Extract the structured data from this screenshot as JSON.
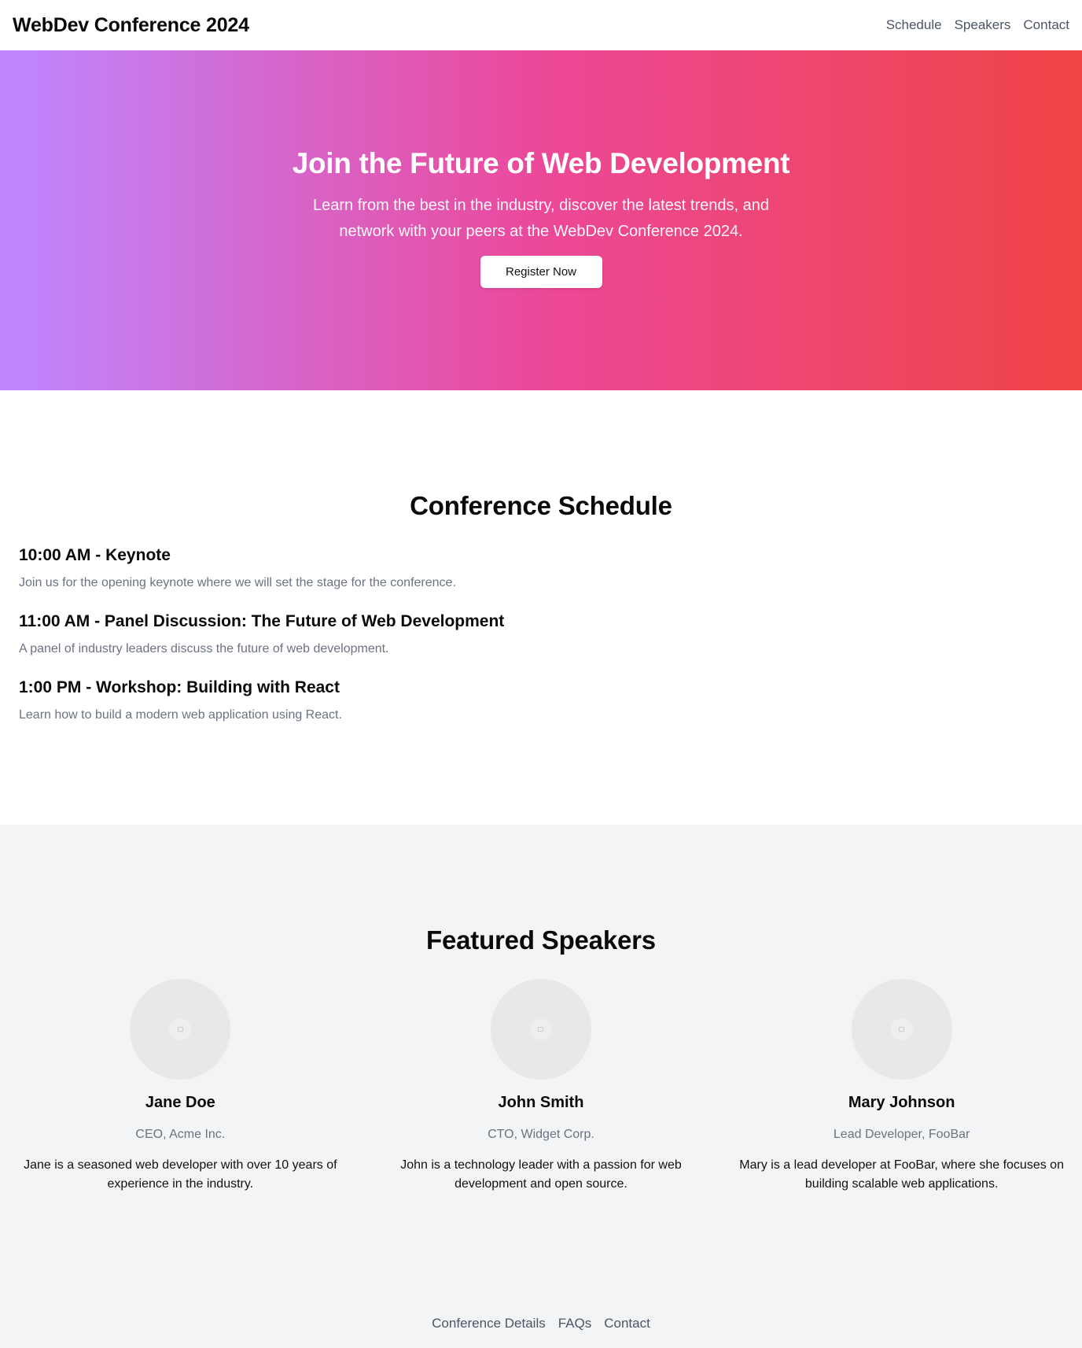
{
  "header": {
    "title": "WebDev Conference 2024",
    "nav": [
      "Schedule",
      "Speakers",
      "Contact"
    ]
  },
  "hero": {
    "title": "Join the Future of Web Development",
    "subtitle": "Learn from the best in the industry, discover the latest trends, and network with your peers at the WebDev Conference 2024.",
    "button_label": "Register Now",
    "gradient_colors": [
      "#c084fc",
      "#ec4899",
      "#ef4444"
    ]
  },
  "schedule": {
    "title": "Conference Schedule",
    "items": [
      {
        "heading": "10:00 AM - Keynote",
        "description": "Join us for the opening keynote where we will set the stage for the conference."
      },
      {
        "heading": "11:00 AM - Panel Discussion: The Future of Web Development",
        "description": "A panel of industry leaders discuss the future of web development."
      },
      {
        "heading": "1:00 PM - Workshop: Building with React",
        "description": "Learn how to build a modern web application using React."
      }
    ]
  },
  "speakers": {
    "title": "Featured Speakers",
    "items": [
      {
        "name": "Jane Doe",
        "role": "CEO, Acme Inc.",
        "bio": "Jane is a seasoned web developer with over 10 years of experience in the industry.",
        "avatar_icon": "image-placeholder-icon"
      },
      {
        "name": "John Smith",
        "role": "CTO, Widget Corp.",
        "bio": "John is a technology leader with a passion for web development and open source.",
        "avatar_icon": "image-placeholder-icon"
      },
      {
        "name": "Mary Johnson",
        "role": "Lead Developer, FooBar",
        "bio": "Mary is a lead developer at FooBar, where she focuses on building scalable web applications.",
        "avatar_icon": "image-placeholder-icon"
      }
    ]
  },
  "footer": {
    "links": [
      "Conference Details",
      "FAQs",
      "Contact"
    ]
  }
}
